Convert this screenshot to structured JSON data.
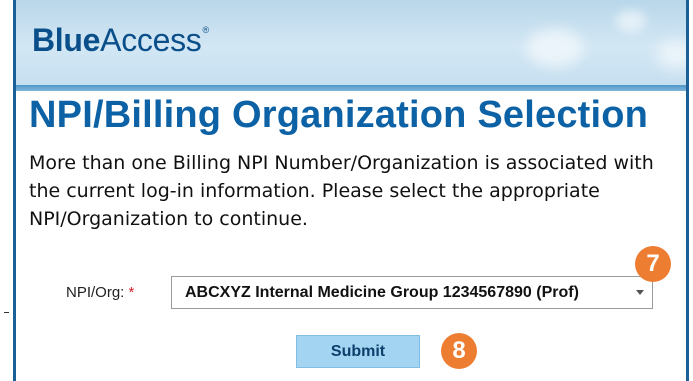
{
  "header": {
    "logo_bold": "Blue",
    "logo_regular": "Access",
    "logo_mark": "®"
  },
  "page": {
    "title": "NPI/Billing Organization Selection",
    "intro": "More than one Billing NPI Number/Organization is associated with the current log-in information. Please select the appropriate NPI/Organization to continue."
  },
  "form": {
    "npi_label": "NPI/Org:",
    "required_marker": "*",
    "selected_value": "ABCXYZ Internal Medicine Group 1234567890 (Prof)",
    "submit_label": "Submit"
  },
  "annotations": {
    "step_7": "7",
    "step_8": "8",
    "badge_color": "#ed7d31"
  },
  "colors": {
    "brand_blue": "#0d62a6",
    "button_bg": "#a3d4f1"
  }
}
